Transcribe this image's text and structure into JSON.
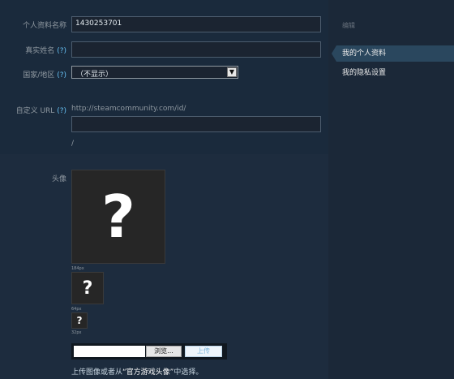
{
  "form": {
    "profile_name_label": "个人资料名称",
    "profile_name_value": "1430253701",
    "real_name_label": "真实姓名",
    "help_mark": "(?)",
    "country_label": "国家/地区",
    "country_value": "（不显示）",
    "custom_url_label": "自定义 URL",
    "url_prefix": "http://steamcommunity.com/id/",
    "url_suffix": "/",
    "avatar_label": "头像"
  },
  "avatar": {
    "placeholder_glyph": "?",
    "size_large": "184px",
    "size_medium": "64px",
    "size_small": "32px"
  },
  "upload": {
    "browse_label": "浏览...",
    "upload_label": "上传",
    "hint_prefix": "上传图像或者从",
    "hint_link": "“官方游戏头像”",
    "hint_suffix": "中选择。"
  },
  "sidebar": {
    "header": "编辑",
    "items": [
      {
        "label": "我的个人资料",
        "active": true
      },
      {
        "label": "我的隐私设置",
        "active": false
      }
    ]
  },
  "colors": {
    "accent": "#66c0f4",
    "active_item": "#2a475e",
    "background": "#1b2838"
  }
}
